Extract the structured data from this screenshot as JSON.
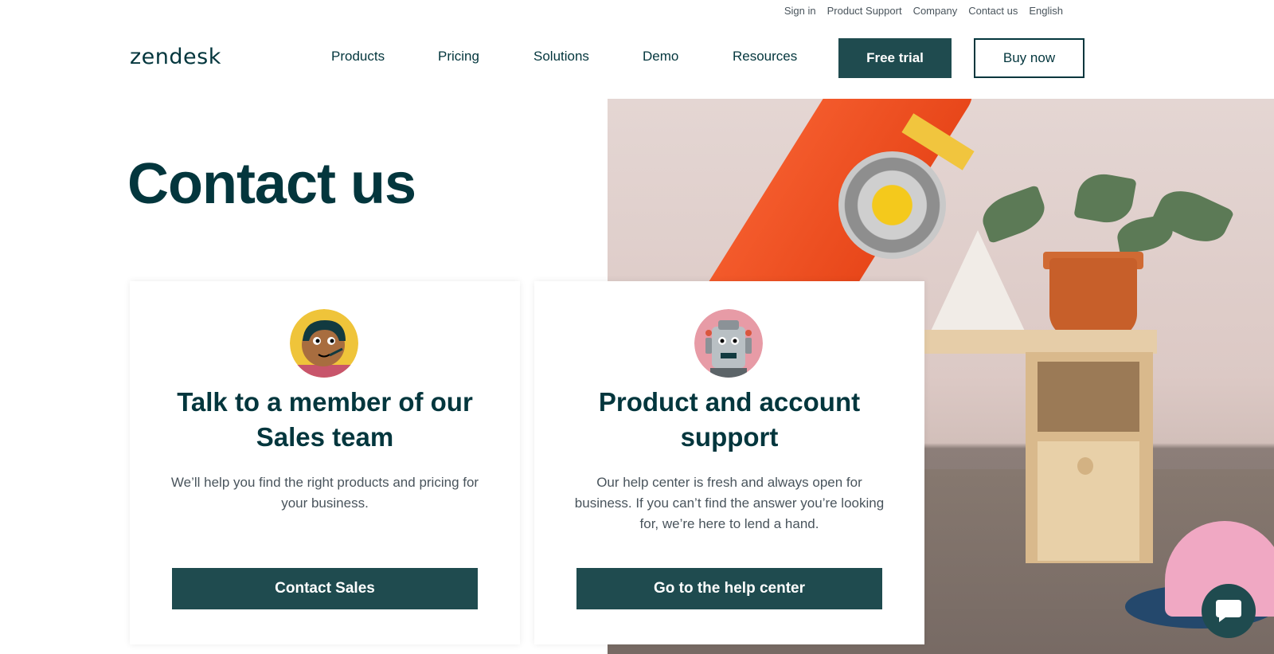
{
  "utility_nav": {
    "items": [
      "Sign in",
      "Product Support",
      "Company",
      "Contact us",
      "English"
    ]
  },
  "header": {
    "logo": "zendesk",
    "nav": [
      "Products",
      "Pricing",
      "Solutions",
      "Demo",
      "Resources"
    ],
    "free_trial": "Free trial",
    "buy_now": "Buy now"
  },
  "page": {
    "title": "Contact us"
  },
  "cards": {
    "sales": {
      "heading": "Talk to a member of our Sales team",
      "body": "We’ll help you find the right products and pricing for your business.",
      "cta": "Contact Sales"
    },
    "support": {
      "heading": "Product and account support",
      "body": "Our help center is fresh and always open for business. If you can’t find the answer you’re looking for, we’re here to lend a hand.",
      "cta": "Go to the help center"
    }
  },
  "colors": {
    "brand_dark": "#03363d",
    "button": "#1f4b4f"
  },
  "icons": [
    "sales-agent-avatar-icon",
    "support-robot-avatar-icon",
    "chat-bubble-icon"
  ]
}
